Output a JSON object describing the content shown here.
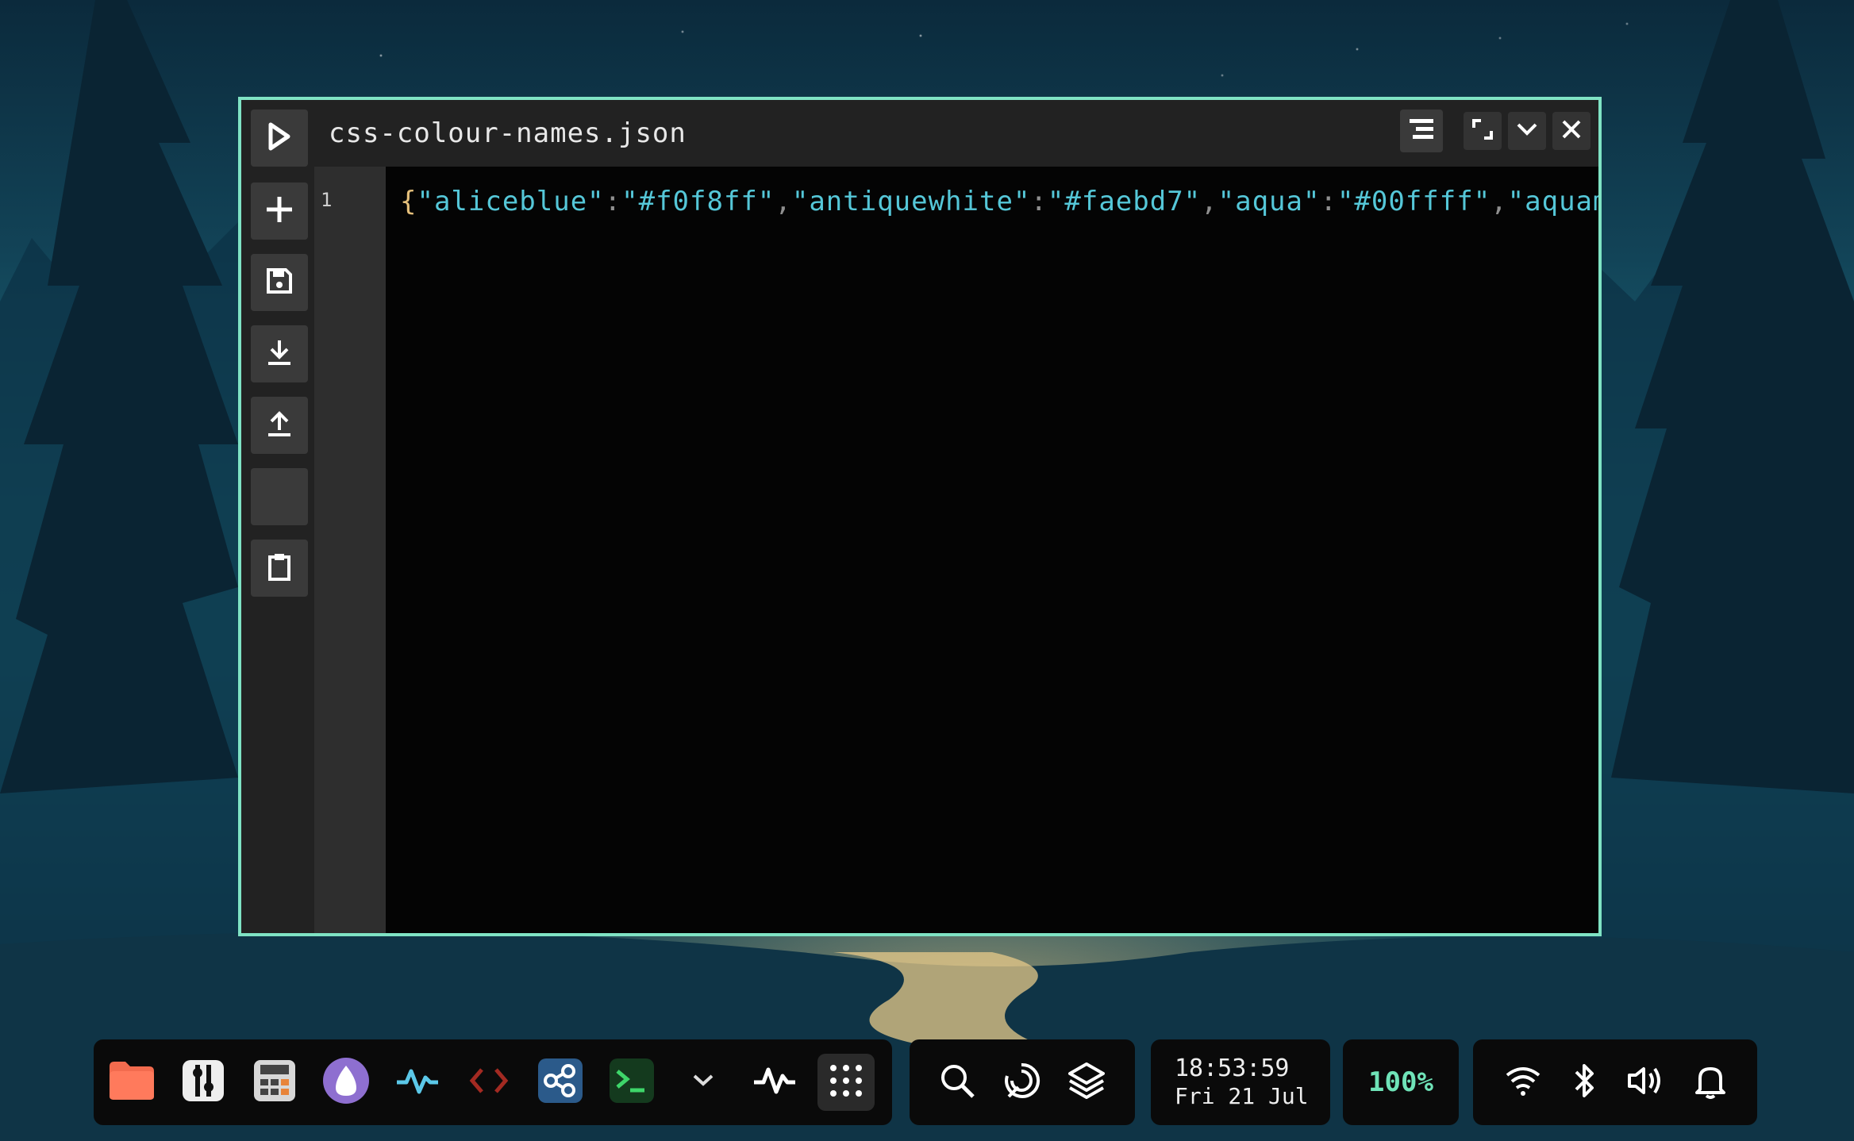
{
  "editor": {
    "file_title": "css-colour-names.json",
    "line_numbers": [
      "1"
    ],
    "code": {
      "open_brace": "{",
      "entries": [
        {
          "key": "\"aliceblue\"",
          "value": "\"#f0f8ff\""
        },
        {
          "key": "\"antiquewhite\"",
          "value": "\"#faebd7\""
        },
        {
          "key": "\"aqua\"",
          "value": "\"#00ffff\""
        }
      ],
      "trailing": "\"aquamarine"
    },
    "toolbar_icons": [
      "run-icon",
      "plus-icon",
      "save-icon",
      "download-icon",
      "upload-icon",
      "blank",
      "clipboard-icon"
    ],
    "window_controls": [
      "menu-icon",
      "maximize-icon",
      "minimize-icon",
      "close-icon"
    ]
  },
  "taskbar": {
    "dock_apps": [
      "files",
      "settings",
      "calculator",
      "launcher",
      "activity-monitor",
      "code-editor",
      "network",
      "terminal",
      "chevron",
      "pulse",
      "app-grid"
    ],
    "tools": [
      "search-icon",
      "refresh-icon",
      "layers-icon"
    ],
    "clock": {
      "time": "18:53:59",
      "date": "Fri 21 Jul"
    },
    "battery": "100%",
    "system_tray": [
      "wifi-icon",
      "bluetooth-icon",
      "volume-icon",
      "bell-icon"
    ]
  },
  "colors": {
    "window_border": "#7fe3c4",
    "code_string": "#55c7d8",
    "code_brace": "#e5c07b",
    "battery_text": "#6fe3b8"
  }
}
